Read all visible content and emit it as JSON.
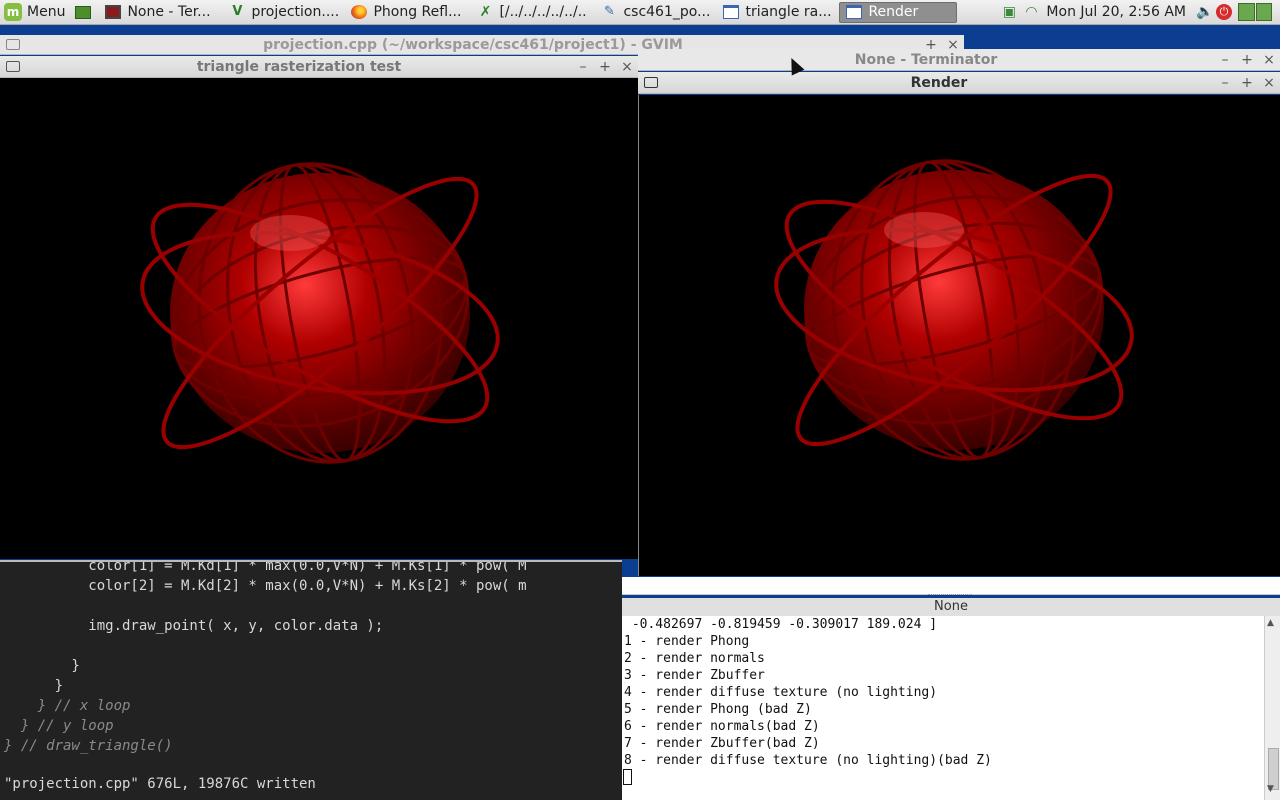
{
  "panel": {
    "menu_label": "Menu",
    "tasks": [
      {
        "label": "None - Ter...",
        "icon": "terminal-icon"
      },
      {
        "label": "projection....",
        "icon": "gvim-icon"
      },
      {
        "label": "Phong Refl...",
        "icon": "firefox-icon"
      },
      {
        "label": "[/../../../../../..",
        "icon": "tools-icon"
      },
      {
        "label": "csc461_po...",
        "icon": "document-icon"
      },
      {
        "label": "triangle ra...",
        "icon": "window-icon"
      },
      {
        "label": "Render",
        "icon": "window-icon",
        "active": true
      }
    ],
    "clock": "Mon Jul 20,  2:56 AM"
  },
  "windows": {
    "gvim_title": "projection.cpp (~/workspace/csc461/project1) - GVIM",
    "triangle_title": "triangle rasterization test",
    "terminator_title": "None - Terminator",
    "render_title": "Render"
  },
  "editor": {
    "lines": [
      "          color[1] = M.Kd[1] * max(0.0,V*N) + M.Ks[1] * pow( M",
      "          color[2] = M.Kd[2] * max(0.0,V*N) + M.Ks[2] * pow( m",
      "",
      "          img.draw_point( x, y, color.data );",
      "",
      "        }",
      "      }",
      "    } // x loop",
      "  } // y loop",
      "} // draw_triangle()"
    ],
    "status": "\"projection.cpp\" 676L, 19876C written"
  },
  "terminal": {
    "header": "None",
    "lines": [
      " -0.482697 -0.819459 -0.309017 189.024 ]",
      "1 - render Phong",
      "2 - render normals",
      "3 - render Zbuffer",
      "4 - render diffuse texture (no lighting)",
      "5 - render Phong (bad Z)",
      "6 - render normals(bad Z)",
      "7 - render Zbuffer(bad Z)",
      "8 - render diffuse texture (no lighting)(bad Z)"
    ]
  },
  "colors": {
    "model_red": "#8c0000",
    "desktop_blue": "#0b3d91"
  }
}
